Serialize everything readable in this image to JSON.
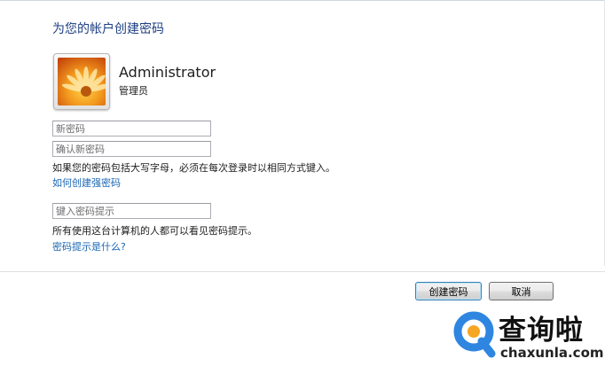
{
  "header": {
    "title": "为您的帐户创建密码"
  },
  "user": {
    "name": "Administrator",
    "role": "管理员",
    "avatar_icon": "orange-flower-avatar"
  },
  "form": {
    "new_password": {
      "placeholder": "新密码",
      "value": ""
    },
    "confirm_password": {
      "placeholder": "确认新密码",
      "value": ""
    },
    "caps_notice": "如果您的密码包括大写字母，必须在每次登录时以相同方式键入。",
    "strong_password_link": "如何创建强密码",
    "hint": {
      "placeholder": "键入密码提示",
      "value": ""
    },
    "hint_notice": "所有使用这台计算机的人都可以看见密码提示。",
    "hint_link": "密码提示是什么?"
  },
  "buttons": {
    "create": "创建密码",
    "cancel": "取消"
  },
  "watermark": {
    "text": "查询啦",
    "url": "chaxunla.com"
  },
  "colors": {
    "title": "#1e3f82",
    "link": "#1a66b3",
    "divider": "#dfdfdf",
    "logo_blue": "#2f86e0",
    "logo_orange": "#f5a623"
  }
}
